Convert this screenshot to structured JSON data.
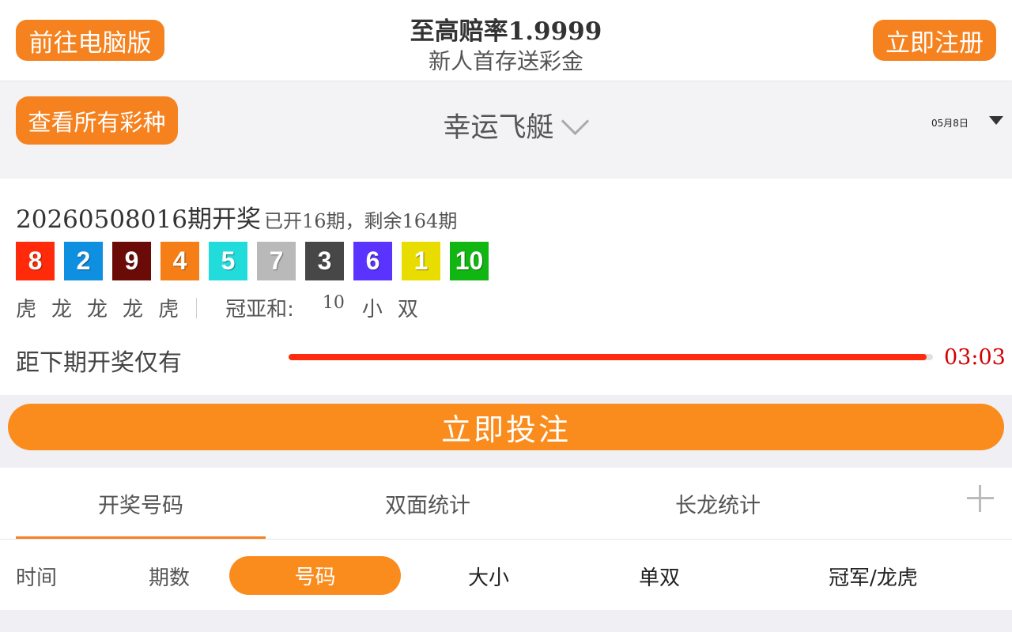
{
  "header": {
    "pc_button": "前往电脑版",
    "title": "至高赔率1.9999",
    "subtitle": "新人首存送彩金",
    "register_button": "立即注册"
  },
  "selector": {
    "all_button": "查看所有彩种",
    "lottery_name": "幸运飞艇",
    "date": "05月8日"
  },
  "draw": {
    "issue": "20260508016期开奖",
    "progress_text": "已开16期，剩余164期",
    "balls": [
      {
        "num": "8",
        "color": "#ff2a0a"
      },
      {
        "num": "2",
        "color": "#0f8fe0"
      },
      {
        "num": "9",
        "color": "#6b0b07"
      },
      {
        "num": "4",
        "color": "#f57f16"
      },
      {
        "num": "5",
        "color": "#22dcdc"
      },
      {
        "num": "7",
        "color": "#b9b9b9"
      },
      {
        "num": "3",
        "color": "#474747"
      },
      {
        "num": "6",
        "color": "#5a33ff"
      },
      {
        "num": "1",
        "color": "#e8dc00"
      },
      {
        "num": "10",
        "color": "#12b612"
      }
    ],
    "longhu": [
      "虎",
      "龙",
      "龙",
      "龙",
      "虎"
    ],
    "sum_label": "冠亚和:",
    "sum_value": "10",
    "sum_size": "小",
    "sum_oe": "双",
    "countdown_label": "距下期开奖仅有",
    "countdown_progress": 0.99,
    "timer": "03:03"
  },
  "bet_button": "立即投注",
  "tabs": [
    "开奖号码",
    "双面统计",
    "长龙统计"
  ],
  "filters": {
    "time": "时间",
    "issue": "期数",
    "number": "号码",
    "size": "大小",
    "odd_even": "单双",
    "champion": "冠军/龙虎"
  },
  "colors": {
    "accent": "#f5821f",
    "timer": "#d40000",
    "progress": "#ff2b0f"
  }
}
